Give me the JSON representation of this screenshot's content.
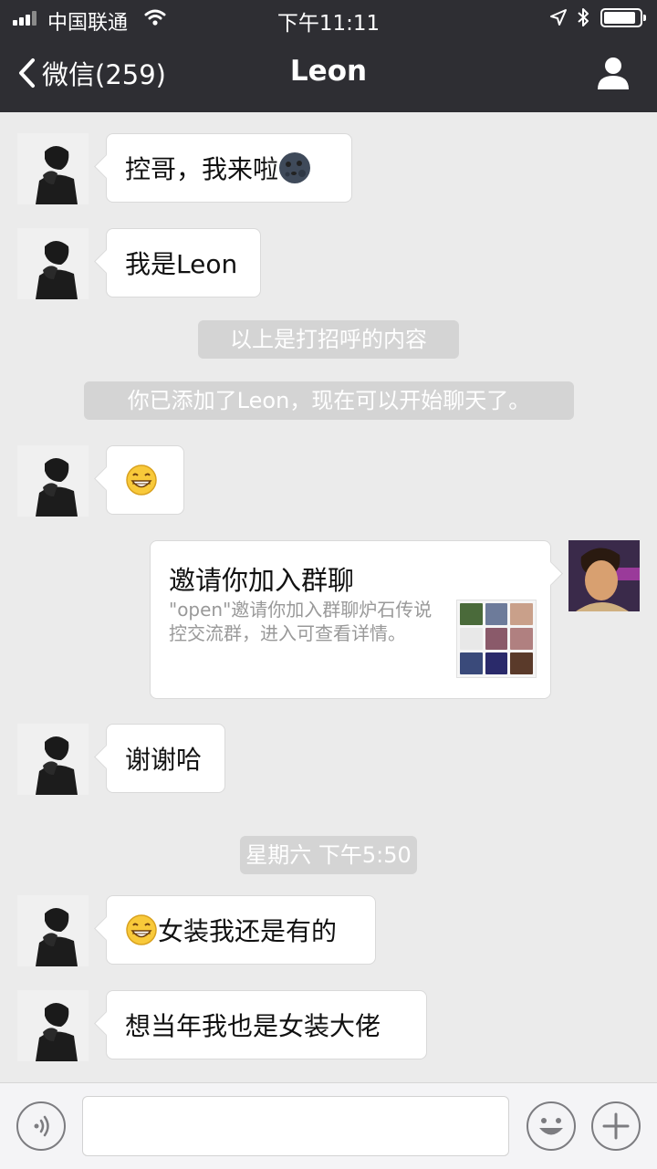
{
  "status_bar": {
    "carrier": "中国联通",
    "time": "下午11:11"
  },
  "nav": {
    "back_label": "微信(259)",
    "title": "Leon"
  },
  "messages": [
    {
      "side": "left",
      "text": "控哥，我来啦",
      "emoji": "moon-face-emoji"
    },
    {
      "side": "left",
      "text": "我是Leon"
    },
    {
      "type": "system",
      "text": "以上是打招呼的内容"
    },
    {
      "type": "system",
      "text": "你已添加了Leon，现在可以开始聊天了。"
    },
    {
      "side": "left",
      "text": "",
      "emoji": "grin-emoji"
    },
    {
      "side": "right",
      "type": "card",
      "title": "邀请你加入群聊",
      "desc": "\"open\"邀请你加入群聊炉石传说控交流群，进入可查看详情。"
    },
    {
      "side": "left",
      "text": "谢谢哈"
    },
    {
      "type": "timestamp",
      "text": "星期六 下午5:50"
    },
    {
      "side": "left",
      "text": "女装我还是有的",
      "emoji": "grin-emoji"
    },
    {
      "side": "left",
      "text": "想当年我也是女装大佬"
    }
  ],
  "input_bar": {
    "placeholder": ""
  },
  "colors": {
    "nav_bg": "#2e2e33",
    "chat_bg": "#ebebeb",
    "bubble": "#ffffff",
    "system_pill": "#d4d4d4"
  }
}
